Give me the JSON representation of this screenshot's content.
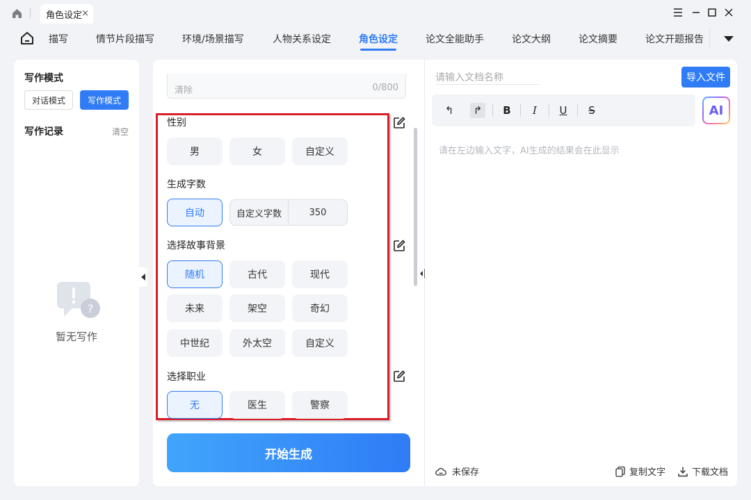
{
  "titlebar": {
    "tab_title": "角色设定",
    "close_glyph": "×"
  },
  "nav": {
    "items": [
      {
        "label": "描写"
      },
      {
        "label": "情节片段描写"
      },
      {
        "label": "环境/场景描写"
      },
      {
        "label": "人物关系设定"
      },
      {
        "label": "角色设定"
      },
      {
        "label": "论文全能助手"
      },
      {
        "label": "论文大纲"
      },
      {
        "label": "论文摘要"
      },
      {
        "label": "论文开题报告"
      }
    ],
    "active_index": 4
  },
  "sidebar": {
    "mode_title": "写作模式",
    "mode_dialog": "对话模式",
    "mode_writing": "写作模式",
    "records_title": "写作记录",
    "clear_label": "清空",
    "empty_text": "暂无写作"
  },
  "form": {
    "textarea_clear": "清除",
    "textarea_count": "0/800",
    "gender": {
      "label": "性别",
      "options": [
        "男",
        "女",
        "自定义"
      ]
    },
    "wordcount": {
      "label": "生成字数",
      "auto": "自动",
      "custom_label": "自定义字数",
      "custom_value": "350"
    },
    "background": {
      "label": "选择故事背景",
      "options": [
        "随机",
        "古代",
        "现代",
        "未来",
        "架空",
        "奇幻",
        "中世纪",
        "外太空",
        "自定义"
      ],
      "selected": "随机"
    },
    "job": {
      "label": "选择职业",
      "options": [
        "无",
        "医生",
        "警察"
      ],
      "selected": "无"
    },
    "generate_label": "开始生成"
  },
  "editor": {
    "docname_placeholder": "请输入文档名称",
    "import_label": "导入文件",
    "toolbar": {
      "undo": "↰",
      "redo": "↱",
      "bold": "B",
      "italic": "I",
      "underline": "U",
      "strike": "S"
    },
    "ai_label": "AI",
    "placeholder": "请在左边输入文字，AI生成的结果会在此显示",
    "unsaved": "未保存",
    "copy_label": "复制文字",
    "download_label": "下载文档"
  },
  "colors": {
    "accent": "#2f7cf6",
    "highlight_box": "#d81e2a"
  }
}
